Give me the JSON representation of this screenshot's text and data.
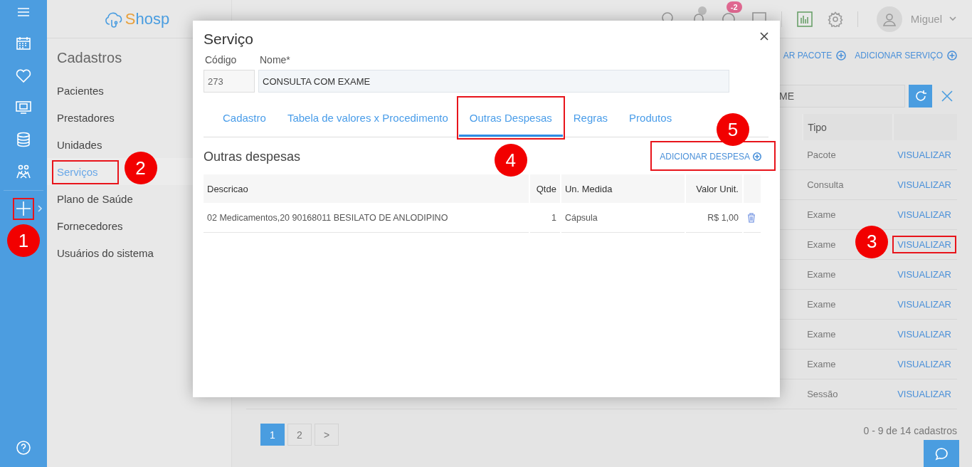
{
  "rail": {
    "annotation": {
      "number": "1"
    }
  },
  "logo": {
    "initial": "S",
    "rest": "hosp"
  },
  "sidebar": {
    "title": "Cadastros",
    "items": [
      {
        "label": "Pacientes",
        "selected": false
      },
      {
        "label": "Prestadores",
        "selected": false
      },
      {
        "label": "Unidades",
        "selected": false
      },
      {
        "label": "Serviços",
        "selected": true,
        "annotation": {
          "number": "2"
        }
      },
      {
        "label": "Plano de Saúde",
        "selected": false
      },
      {
        "label": "Fornecedores",
        "selected": false
      },
      {
        "label": "Usuários do sistema",
        "selected": false
      }
    ]
  },
  "header": {
    "notification_badge": "-2",
    "user": "Miguel"
  },
  "main": {
    "actions": [
      "AR PACOTE",
      "ADICIONAR SERVIÇO"
    ],
    "search": {
      "value": "ME"
    },
    "table": {
      "columns": [
        "Tipo"
      ],
      "rows": [
        {
          "tipo": "Pacote",
          "action": "VISUALIZAR"
        },
        {
          "tipo": "Consulta",
          "action": "VISUALIZAR"
        },
        {
          "tipo": "Exame",
          "action": "VISUALIZAR"
        },
        {
          "tipo": "Exame",
          "action": "VISUALIZAR",
          "annotation": {
            "number": "3"
          }
        },
        {
          "tipo": "Exame",
          "action": "VISUALIZAR"
        },
        {
          "tipo": "Exame",
          "action": "VISUALIZAR"
        },
        {
          "tipo": "Exame",
          "action": "VISUALIZAR"
        },
        {
          "tipo": "Exame",
          "action": "VISUALIZAR"
        },
        {
          "tipo": "Sessão",
          "action": "VISUALIZAR"
        }
      ]
    },
    "pagination": [
      {
        "label": "1",
        "selected": true
      },
      {
        "label": "2",
        "selected": false
      },
      {
        "label": ">",
        "selected": false
      }
    ],
    "count": "0 - 9 de 14 cadastros"
  },
  "modal": {
    "title": "Serviço",
    "fields": [
      {
        "label": "Código",
        "value": "273",
        "disabled": true
      },
      {
        "label": "Nome*",
        "value": "CONSULTA COM EXAME",
        "disabled": false
      }
    ],
    "tabs": [
      {
        "label": "Cadastro",
        "selected": false
      },
      {
        "label": "Tabela de valores x Procedimento",
        "selected": false
      },
      {
        "label": "Outras Despesas",
        "selected": true,
        "annotation": {
          "number": "4"
        }
      },
      {
        "label": "Regras",
        "selected": false
      },
      {
        "label": "Produtos",
        "selected": false
      }
    ],
    "section_title": "Outras despesas",
    "add_link": {
      "label": "ADICIONAR DESPESA",
      "annotation": {
        "number": "5"
      }
    },
    "table": {
      "columns": [
        "Descricao",
        "Qtde",
        "Un. Medida",
        "Valor Unit."
      ],
      "rows": [
        [
          "02 Medicamentos,20 90168011 BESILATO DE ANLODIPINO",
          "1",
          "Cápsula",
          "R$ 1,00"
        ]
      ]
    }
  }
}
